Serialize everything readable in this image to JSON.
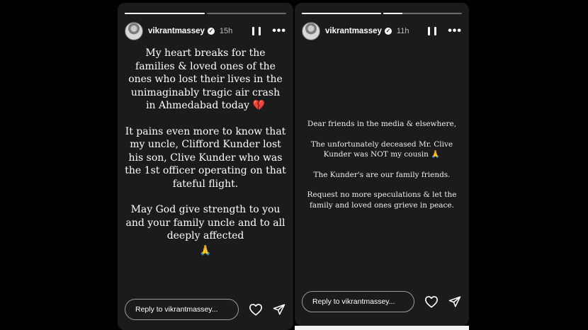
{
  "stories": [
    {
      "username": "vikrantmassey",
      "time": "15h",
      "progress": [
        1.0,
        0.0
      ],
      "paragraphs": [
        "My heart breaks for the families & loved ones of the ones who lost their lives in the unimaginably tragic air crash in Ahmedabad today",
        "It pains even more to know that my uncle, Clifford Kunder lost his son, Clive Kunder who was the 1st officer operating on that fateful flight.",
        "May God give strength to you and your family uncle and to all deeply affected"
      ],
      "emoji_broken_heart": "💔",
      "emoji_pray": "🙏",
      "reply_placeholder": "Reply to vikrantmassey..."
    },
    {
      "username": "vikrantmassey",
      "time": "11h",
      "progress": [
        1.0,
        0.25
      ],
      "paragraphs": [
        "Dear friends in the media & elsewhere,",
        "The unfortunately deceased Mr. Clive Kunder was NOT my cousin",
        "The Kunder's are our family friends.",
        "Request no more speculations & let the family and loved ones grieve in peace."
      ],
      "emoji_pray": "🙏",
      "reply_placeholder": "Reply to vikrantmassey..."
    }
  ]
}
